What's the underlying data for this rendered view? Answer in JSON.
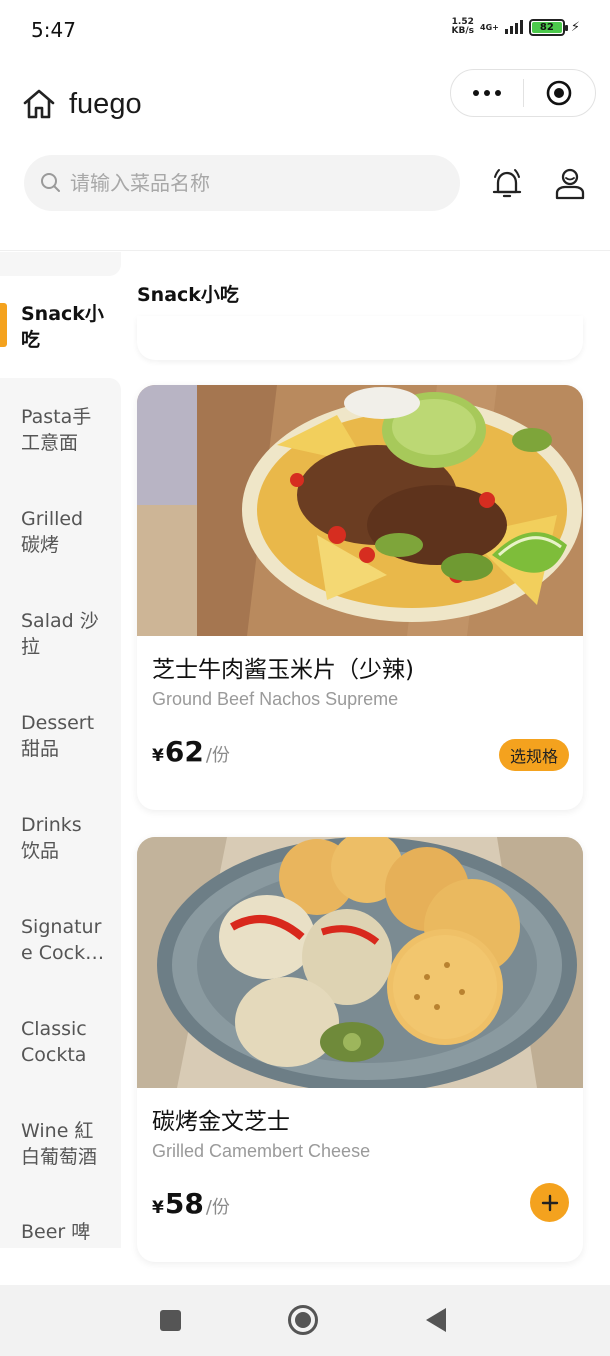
{
  "status_bar": {
    "time": "5:47",
    "net_speed_value": "1.52",
    "net_speed_unit": "KB/s",
    "network_type": "4G+",
    "battery_level": "82"
  },
  "title_bar": {
    "brand": "fuego",
    "home_icon": "home-icon",
    "more_icon": "more-dots-icon",
    "target_icon": "target-icon"
  },
  "search": {
    "placeholder": "请输入菜品名称",
    "bell_icon": "bell-icon",
    "user_icon": "user-icon"
  },
  "sidebar": {
    "items": [
      {
        "label": "Snack小吃",
        "active": true
      },
      {
        "label": "Pasta手工意面",
        "active": false
      },
      {
        "label": "Grilled 碳烤",
        "active": false
      },
      {
        "label": "Salad 沙拉",
        "active": false
      },
      {
        "label": "Dessert 甜品",
        "active": false
      },
      {
        "label": "Drinks 饮品",
        "active": false
      },
      {
        "label": "Signature Cock…",
        "active": false
      },
      {
        "label": "Classic Cocktai…",
        "active": false
      },
      {
        "label": "Wine 紅白葡萄酒",
        "active": false
      },
      {
        "label": "Beer 啤",
        "active": false
      }
    ]
  },
  "main": {
    "section_title": "Snack小吃",
    "dishes": [
      {
        "name_cn": "芝士牛肉酱玉米片（少辣)",
        "name_en": "Ground Beef Nachos Supreme",
        "currency": "¥",
        "price": "62",
        "unit": "/份",
        "action_label": "选规格"
      },
      {
        "name_cn": "碳烤金文芝士",
        "name_en": "Grilled Camembert Cheese",
        "currency": "¥",
        "price": "58",
        "unit": "/份",
        "action_icon": "plus-icon"
      }
    ]
  },
  "colors": {
    "accent": "#f4a21e",
    "sidebar_bg": "#f6f6f6",
    "battery": "#4cc94c"
  }
}
